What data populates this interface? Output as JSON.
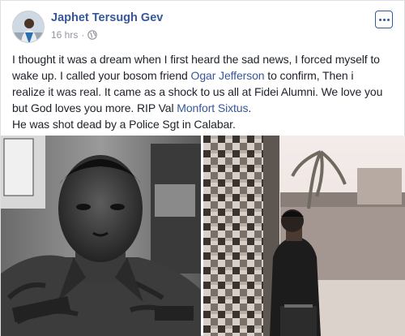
{
  "post": {
    "author": "Japhet Tersugh Gev",
    "time": "16 hrs",
    "dot": "·",
    "privacy_icon": "globe-icon",
    "more_icon": "more-options-icon",
    "body": {
      "line1": "I thought it was a dream when I first heard the sad news, I forced myself to",
      "line2a": "wake up. I called your bosom friend ",
      "line2_link": "Ogar Jefferson",
      "line2b": " to confirm, Then i",
      "line3": "realize it was real. It came as a shock to us all at Fidei Alumni. We love you",
      "line4a": "but God loves you more. RIP Val ",
      "line4_link": "Monfort Sixtus",
      "line4b": ".",
      "line5": "He was shot dead by a Police Sgt in Calabar."
    },
    "photos": [
      {
        "description_icon": "photo-soldier-portrait"
      },
      {
        "description_icon": "photo-man-standing-by-wall"
      }
    ]
  },
  "colors": {
    "link": "#365899",
    "text": "#1d2129",
    "meta": "#90949c",
    "border": "#dddfe2"
  }
}
